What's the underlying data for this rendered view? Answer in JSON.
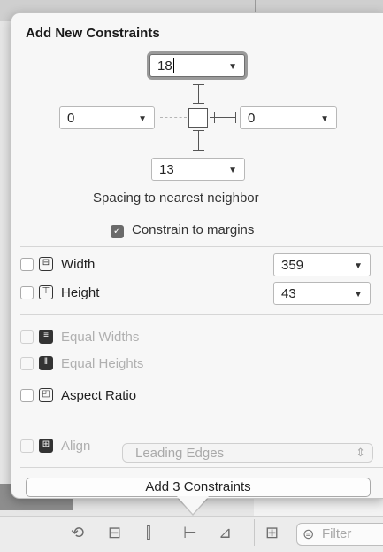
{
  "popover": {
    "title": "Add New Constraints",
    "spacing": {
      "top": "18",
      "left": "0",
      "right": "0",
      "bottom": "13"
    },
    "spacing_caption": "Spacing to nearest neighbor",
    "constrain_to_margins": {
      "label": "Constrain to margins",
      "checked": true
    },
    "size": [
      {
        "label": "Width",
        "value": "359",
        "checked": false
      },
      {
        "label": "Height",
        "value": "43",
        "checked": false
      }
    ],
    "relations": [
      {
        "label": "Equal Widths",
        "enabled": false
      },
      {
        "label": "Equal Heights",
        "enabled": false
      },
      {
        "label": "Aspect Ratio",
        "enabled": true
      }
    ],
    "align": {
      "label": "Align",
      "value": "Leading Edges",
      "enabled": false
    },
    "add_button": "Add 3 Constraints"
  },
  "bottom_bar": {
    "filter_placeholder": "Filter",
    "icons": [
      "update-frames-icon",
      "embed-in-stack-icon",
      "align-icon",
      "pin-icon",
      "resolve-issues-icon",
      "grid-icon",
      "filter-icon"
    ]
  }
}
